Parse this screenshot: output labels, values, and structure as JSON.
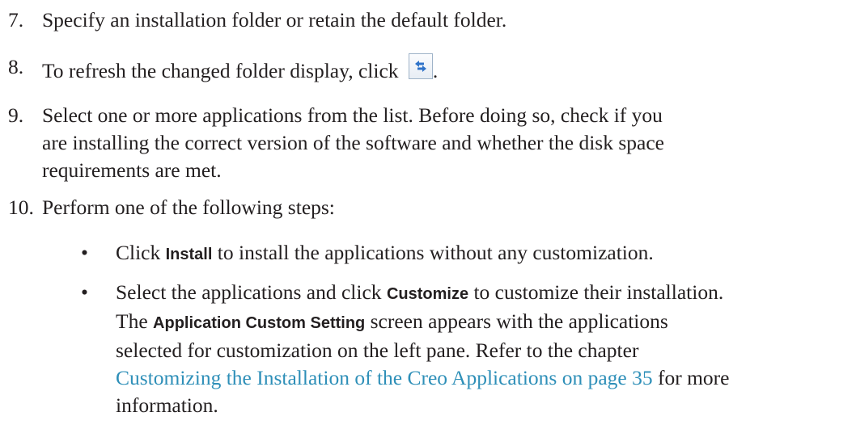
{
  "steps": [
    {
      "number": "7.",
      "text": "Specify an installation folder or retain the default folder."
    },
    {
      "number": "8.",
      "text_before": "To refresh the changed folder display, click ",
      "text_after": ".",
      "icon": "refresh-icon"
    },
    {
      "number": "9.",
      "lines": [
        "Select one or more applications from the list. Before doing so, check if you",
        "are installing the correct version of the software and whether the disk space",
        "requirements are met."
      ]
    },
    {
      "number": "10.",
      "text": "Perform one of the following steps:"
    }
  ],
  "bullets": [
    {
      "symbol": "•",
      "pre": "Click ",
      "bold": "Install",
      "post": " to install the applications without any customization."
    },
    {
      "symbol": "•",
      "line1_pre": "Select the applications and click ",
      "line1_bold": "Customize",
      "line1_post": " to customize their installation.",
      "line2_pre": "The ",
      "line2_bold": "Application Custom Setting",
      "line2_post": " screen appears with the applications",
      "line3": "selected for customization on the left pane.  Refer to the chapter",
      "line4_link": "Customizing the Installation of the Creo Applications on page 35",
      "line4_post": " for more",
      "line5": "information."
    }
  ],
  "colors": {
    "text": "#231f20",
    "link": "#2e8fb8"
  }
}
